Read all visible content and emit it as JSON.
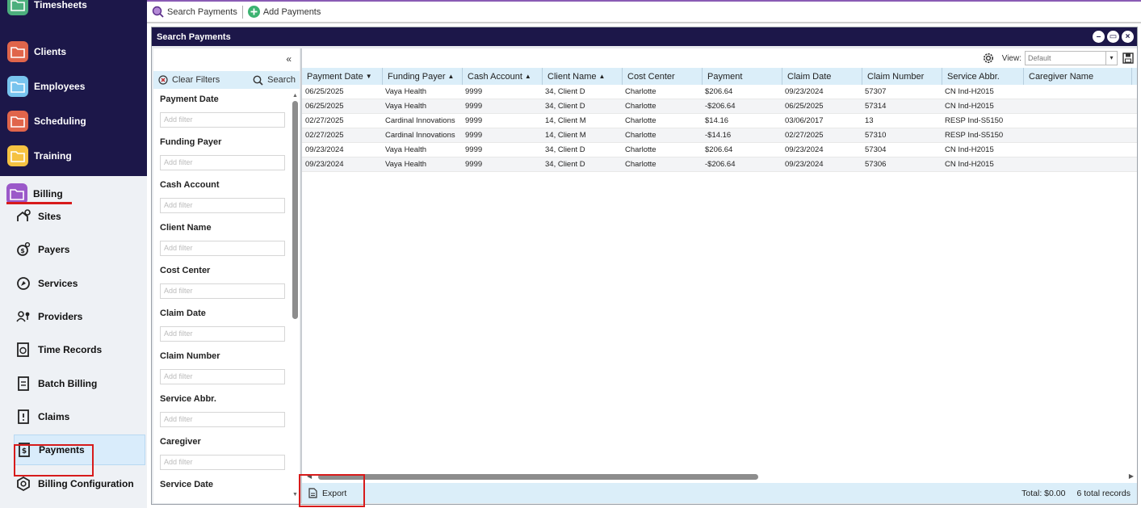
{
  "nav": {
    "top_items": [
      {
        "label": "Timesheets",
        "icon": "timesheets-icon",
        "color": "#4caf7d"
      },
      {
        "label": "Clients",
        "icon": "folder-icon",
        "color": "#e0654b"
      },
      {
        "label": "Employees",
        "icon": "folder-icon",
        "color": "#78c4ee"
      },
      {
        "label": "Scheduling",
        "icon": "calendar-icon",
        "color": "#e0654b"
      },
      {
        "label": "Training",
        "icon": "folder-icon",
        "color": "#f5c242"
      }
    ],
    "billing": {
      "label": "Billing",
      "icon": "folder-icon",
      "color": "#9b59c9"
    },
    "sub_items": [
      {
        "label": "Sites",
        "icon": "sites-icon"
      },
      {
        "label": "Payers",
        "icon": "payers-icon"
      },
      {
        "label": "Services",
        "icon": "services-icon"
      },
      {
        "label": "Providers",
        "icon": "providers-icon"
      },
      {
        "label": "Time Records",
        "icon": "time-records-icon"
      },
      {
        "label": "Batch Billing",
        "icon": "batch-billing-icon"
      },
      {
        "label": "Claims",
        "icon": "claims-icon"
      },
      {
        "label": "Payments",
        "icon": "payments-icon",
        "active": true
      },
      {
        "label": "Billing Configuration",
        "icon": "billing-configuration-icon"
      }
    ]
  },
  "toolbar": {
    "search_label": "Search Payments",
    "add_label": "Add Payments"
  },
  "panel": {
    "title": "Search Payments"
  },
  "filters": {
    "clear_label": "Clear Filters",
    "search_label": "Search",
    "placeholder": "Add filter",
    "items": [
      "Payment Date",
      "Funding Payer",
      "Cash Account",
      "Client Name",
      "Cost Center",
      "Claim Date",
      "Claim Number",
      "Service Abbr.",
      "Caregiver",
      "Service Date"
    ]
  },
  "grid": {
    "view_label": "View:",
    "view_value": "Default",
    "columns": [
      {
        "label": "Payment Date",
        "sort": "desc"
      },
      {
        "label": "Funding Payer",
        "sort": "asc"
      },
      {
        "label": "Cash Account",
        "sort": "asc"
      },
      {
        "label": "Client Name",
        "sort": "asc"
      },
      {
        "label": "Cost Center",
        "sort": ""
      },
      {
        "label": "Payment",
        "sort": ""
      },
      {
        "label": "Claim Date",
        "sort": ""
      },
      {
        "label": "Claim Number",
        "sort": ""
      },
      {
        "label": "Service Abbr.",
        "sort": ""
      },
      {
        "label": "Caregiver Name",
        "sort": ""
      }
    ],
    "rows": [
      [
        "06/25/2025",
        "Vaya Health",
        "9999",
        "34, Client D",
        "Charlotte",
        "$206.64",
        "09/23/2024",
        "57307",
        "CN Ind-H2015",
        ""
      ],
      [
        "06/25/2025",
        "Vaya Health",
        "9999",
        "34, Client D",
        "Charlotte",
        "-$206.64",
        "06/25/2025",
        "57314",
        "CN Ind-H2015",
        ""
      ],
      [
        "02/27/2025",
        "Cardinal Innovations",
        "9999",
        "14, Client M",
        "Charlotte",
        "$14.16",
        "03/06/2017",
        "13",
        "RESP Ind-S5150",
        ""
      ],
      [
        "02/27/2025",
        "Cardinal Innovations",
        "9999",
        "14, Client M",
        "Charlotte",
        "-$14.16",
        "02/27/2025",
        "57310",
        "RESP Ind-S5150",
        ""
      ],
      [
        "09/23/2024",
        "Vaya Health",
        "9999",
        "34, Client D",
        "Charlotte",
        "$206.64",
        "09/23/2024",
        "57304",
        "CN Ind-H2015",
        ""
      ],
      [
        "09/23/2024",
        "Vaya Health",
        "9999",
        "34, Client D",
        "Charlotte",
        "-$206.64",
        "09/23/2024",
        "57306",
        "CN Ind-H2015",
        ""
      ]
    ],
    "export_label": "Export",
    "total": "Total: $0.00",
    "record_count": "6 total records"
  },
  "colors": {
    "nav_dark": "#1c1749",
    "accent_blue": "#dbeef9",
    "highlight_red": "#d71b1b"
  }
}
